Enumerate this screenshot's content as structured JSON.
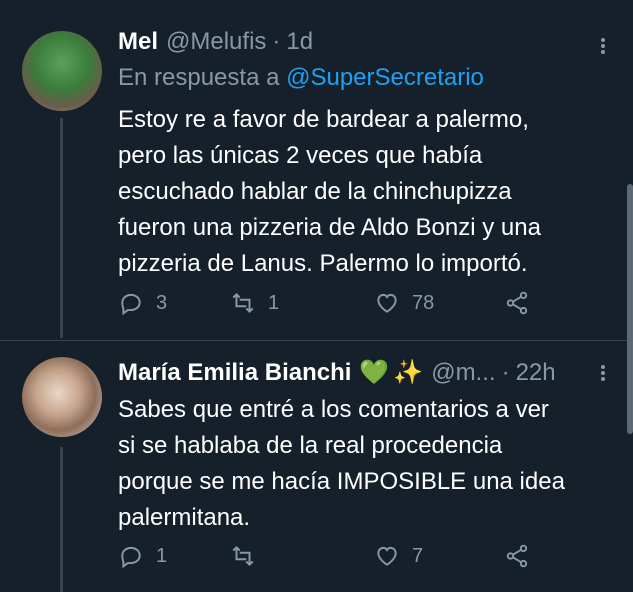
{
  "tweets": [
    {
      "name": "Mel",
      "handle": "@Melufis",
      "dot": "·",
      "time": "1d",
      "reply_prefix": "En respuesta a",
      "reply_mention": "@SuperSecretario",
      "text_lines": [
        "Estoy re a favor de bardear a palermo,",
        "pero las únicas 2 veces que había",
        "escuchado hablar de la chinchupizza",
        "fueron una pizzeria de Aldo Bonzi y una",
        "pizzeria de Lanus. Palermo lo importó."
      ],
      "replies": "3",
      "retweets": "1",
      "likes": "78"
    },
    {
      "name": "María Emilia Bianchi",
      "emoji_heart": "💚",
      "emoji_spark": "✨",
      "handle": "@m...",
      "dot": "·",
      "time": "22h",
      "text_lines": [
        "Sabes que entré a los comentarios a ver",
        "si se hablaba de la real procedencia",
        "porque se me hacía IMPOSIBLE una idea",
        "palermitana."
      ],
      "replies": "1",
      "retweets": "",
      "likes": "7"
    }
  ],
  "colors": {
    "background": "#15202b",
    "secondary_text": "#8899a6",
    "link": "#1da1f2",
    "divider": "#38444d"
  },
  "icons": [
    "reply-icon",
    "retweet-icon",
    "like-icon",
    "share-icon",
    "more-icon"
  ]
}
